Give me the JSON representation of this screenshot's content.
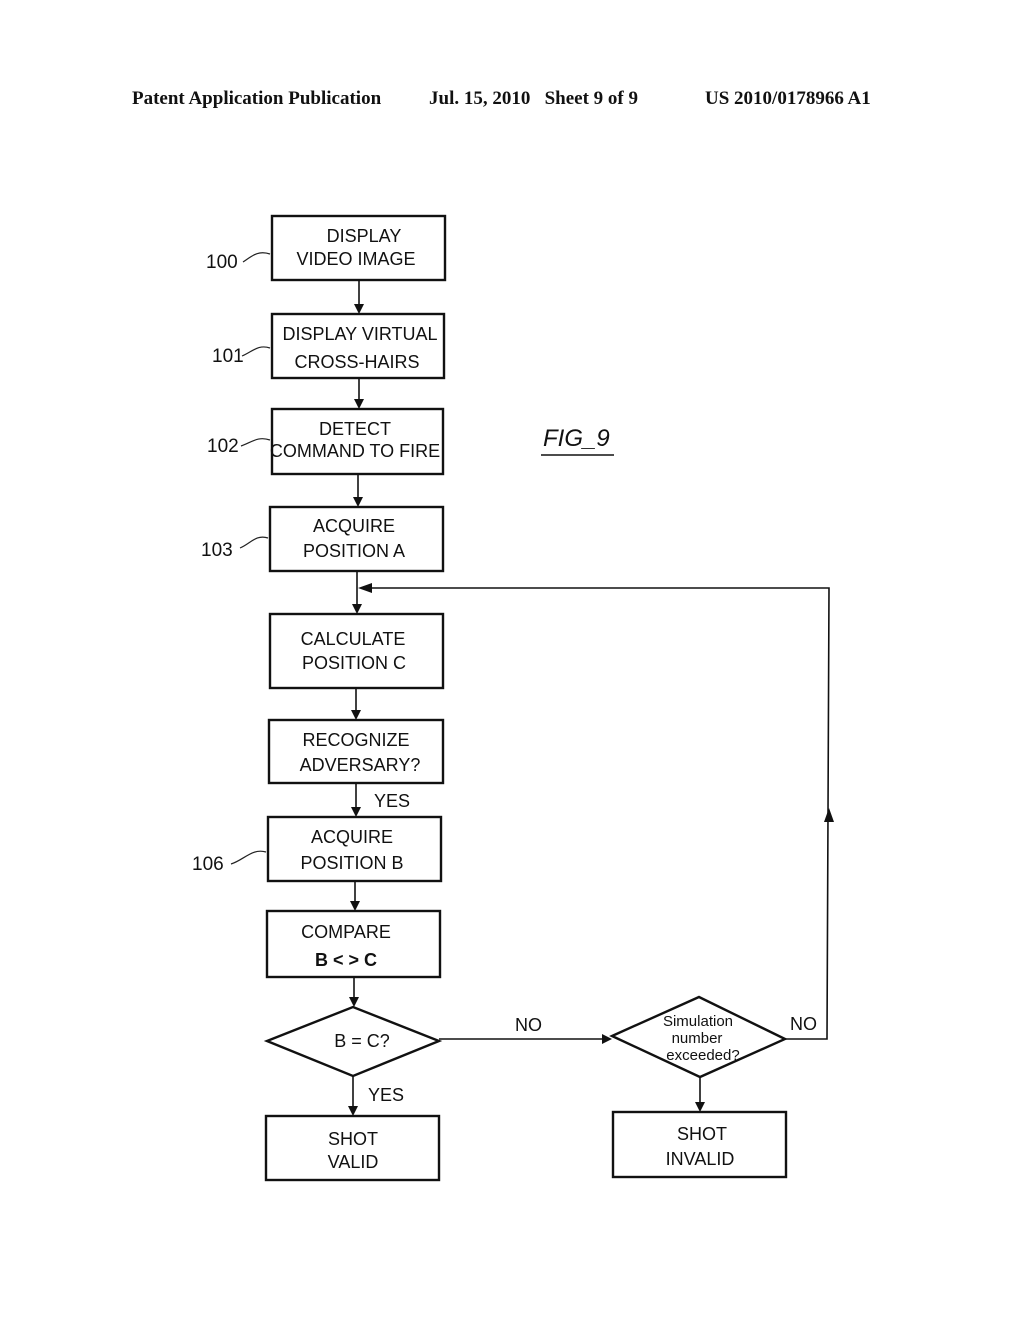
{
  "header": {
    "publication": "Patent Application Publication",
    "date_sheet": "Jul. 15, 2010   Sheet 9 of 9",
    "patent_number": "US 2010/0178966 A1"
  },
  "figure": {
    "label": "FIG_9"
  },
  "flowchart": {
    "steps": [
      {
        "ref": "100",
        "lines": [
          "DISPLAY",
          "VIDEO IMAGE"
        ]
      },
      {
        "ref": "101",
        "lines": [
          "DISPLAY VIRTUAL",
          "CROSS-HAIRS"
        ]
      },
      {
        "ref": "102",
        "lines": [
          "DETECT",
          "COMMAND TO FIRE"
        ]
      },
      {
        "ref": "103",
        "lines": [
          "ACQUIRE",
          "POSITION A"
        ]
      },
      {
        "ref": "",
        "lines": [
          "CALCULATE",
          "POSITION C"
        ]
      },
      {
        "ref": "",
        "lines": [
          "RECOGNIZE",
          "ADVERSARY?"
        ]
      },
      {
        "ref": "106",
        "lines": [
          "ACQUIRE",
          "POSITION B"
        ]
      },
      {
        "ref": "",
        "lines": [
          "COMPARE",
          "B < > C"
        ]
      }
    ],
    "decisions": [
      {
        "lines": [
          "B = C?"
        ]
      },
      {
        "lines": [
          "Simulation",
          "number",
          "exceeded?"
        ]
      }
    ],
    "terminals": [
      {
        "lines": [
          "SHOT",
          "VALID"
        ]
      },
      {
        "lines": [
          "SHOT",
          "INVALID"
        ]
      }
    ],
    "edge_labels": {
      "recognize_yes": "YES",
      "compare_yes": "YES",
      "compare_no": "NO",
      "simulation_no": "NO"
    }
  }
}
